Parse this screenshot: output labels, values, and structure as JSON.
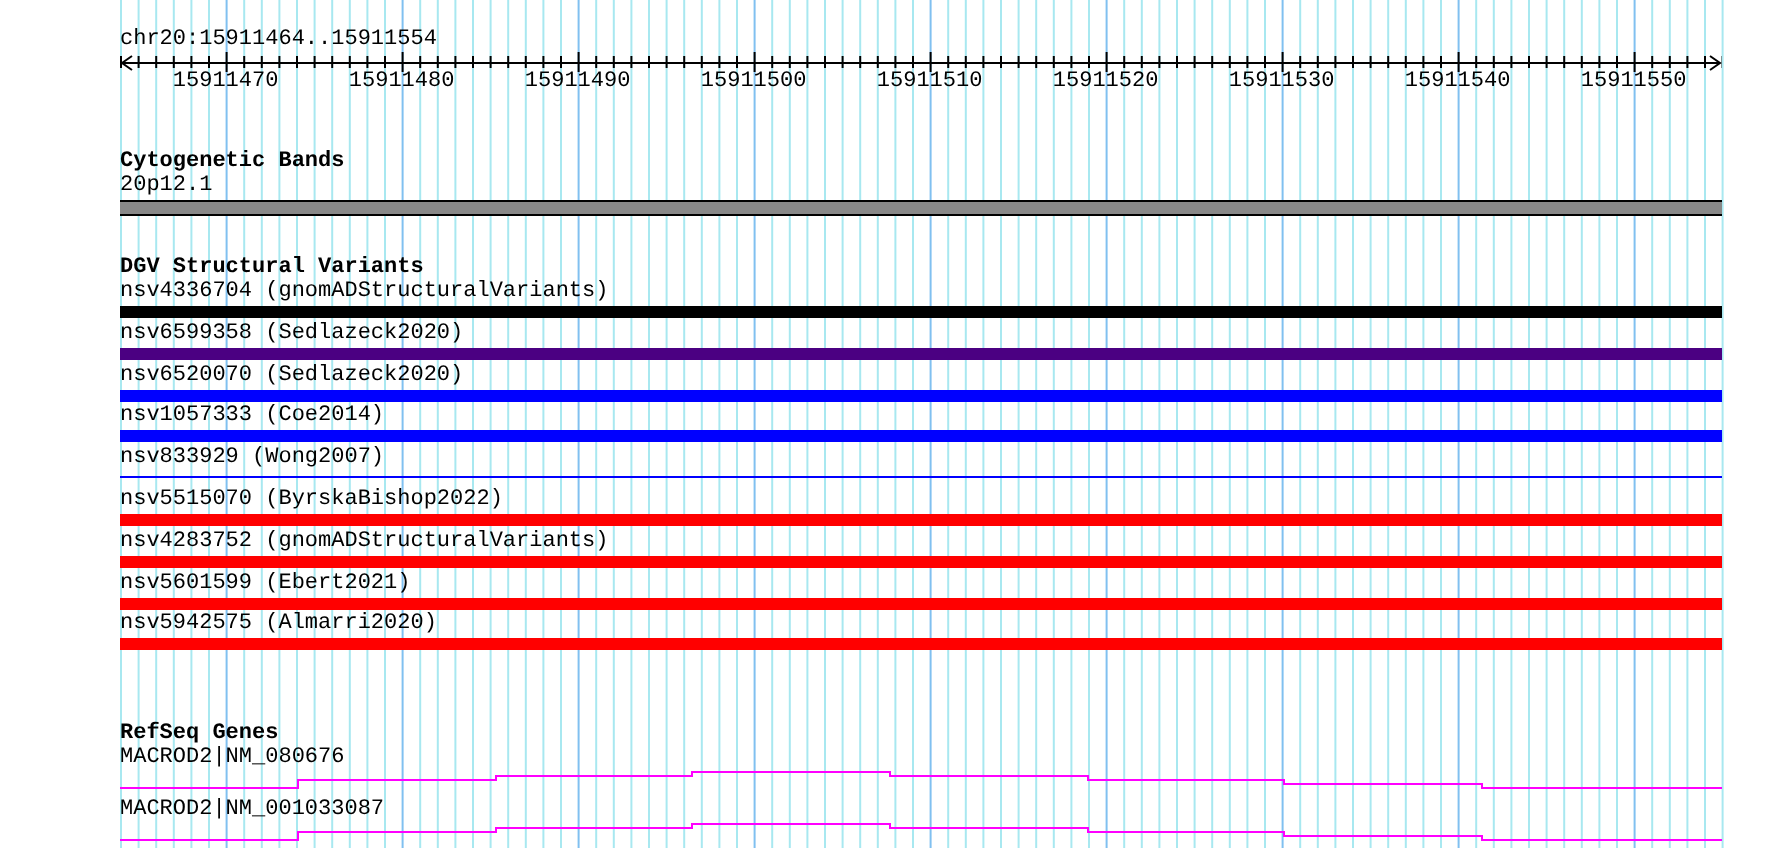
{
  "ruler": {
    "location": "chr20:15911464..15911554",
    "ticks": [
      "15911470",
      "15911480",
      "15911490",
      "15911500",
      "15911510",
      "15911520",
      "15911530",
      "15911540",
      "15911550"
    ]
  },
  "cytogenetic_bands": {
    "title": "Cytogenetic Bands",
    "band": "20p12.1"
  },
  "dgv_structural_variants": {
    "title": "DGV Structural Variants",
    "items": [
      {
        "label": "nsv4336704 (gnomADStructuralVariants)",
        "kind": "thick",
        "color": "#000000"
      },
      {
        "label": "nsv6599358 (Sedlazeck2020)",
        "kind": "thick",
        "color": "#4b0082"
      },
      {
        "label": "nsv6520070 (Sedlazeck2020)",
        "kind": "thick",
        "color": "#0000ff"
      },
      {
        "label": "nsv1057333 (Coe2014)",
        "kind": "thick",
        "color": "#0000ff"
      },
      {
        "label": "nsv833929 (Wong2007)",
        "kind": "thin",
        "color": "#0000ff"
      },
      {
        "label": "nsv5515070 (ByrskaBishop2022)",
        "kind": "thick",
        "color": "#ff0000"
      },
      {
        "label": "nsv4283752 (gnomADStructuralVariants)",
        "kind": "thick",
        "color": "#ff0000"
      },
      {
        "label": "nsv5601599 (Ebert2021)",
        "kind": "thick",
        "color": "#ff0000"
      },
      {
        "label": "nsv5942575 (Almarri2020)",
        "kind": "thick",
        "color": "#ff0000"
      }
    ]
  },
  "refseq_genes": {
    "title": "RefSeq Genes",
    "items": [
      {
        "label": "MACROD2|NM_080676"
      },
      {
        "label": "MACROD2|NM_001033087"
      }
    ]
  }
}
